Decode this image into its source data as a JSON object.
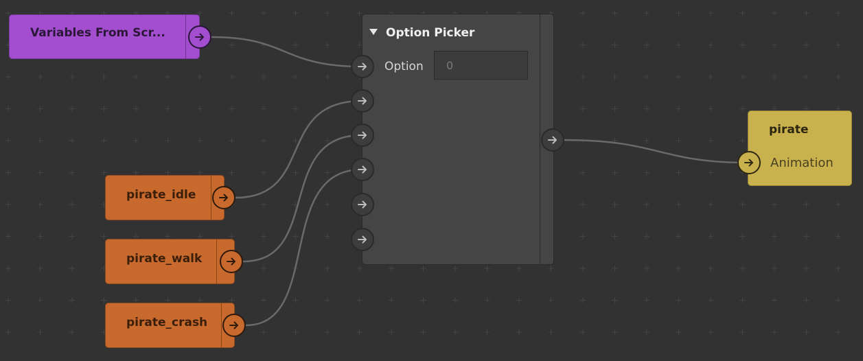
{
  "variables_node": {
    "title": "Variables From Scr..."
  },
  "option_picker": {
    "title": "Option Picker",
    "option_label": "Option",
    "option_value": "0"
  },
  "animation_nodes": [
    {
      "label": "pirate_idle"
    },
    {
      "label": "pirate_walk"
    },
    {
      "label": "pirate_crash"
    }
  ],
  "output_node": {
    "title": "pirate",
    "port_label": "Animation"
  },
  "colors": {
    "background": "#323232",
    "grid_cross": "#444444",
    "variable_node": "#a24ecf",
    "animation_node": "#c86a2e",
    "picker_node": "#454545",
    "output_node": "#c9b14e",
    "wire": "#6a6a6a"
  },
  "icons": {
    "port": "arrow-right-icon",
    "collapse": "triangle-down-icon"
  }
}
